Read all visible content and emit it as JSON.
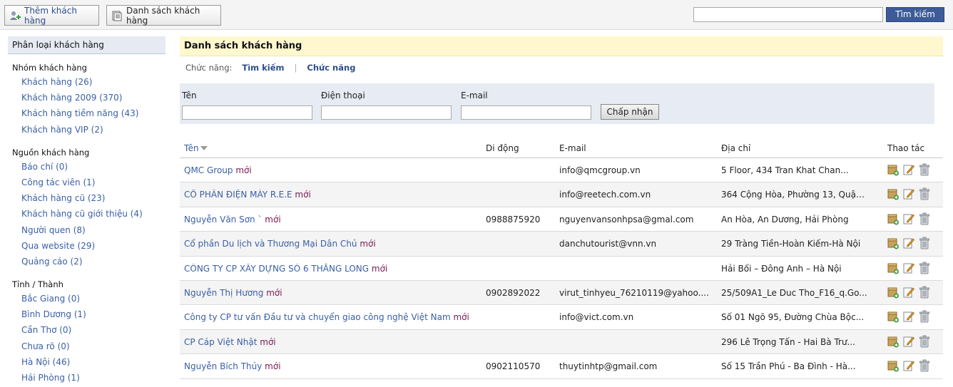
{
  "toolbar": {
    "add_label": "Thêm khách hàng",
    "list_label": "Danh sách khách hàng",
    "search_value": "",
    "search_button": "Tìm kiếm"
  },
  "sidebar": {
    "title": "Phân loại khách hàng",
    "groups": [
      {
        "title": "Nhóm khách hàng",
        "items": [
          "Khách hàng (26)",
          "Khách hàng 2009 (370)",
          "Khách hàng tiềm năng (43)",
          "Khách hàng VIP (2)"
        ]
      },
      {
        "title": "Nguồn khách hàng",
        "items": [
          "Báo chí (0)",
          "Công tác viên (1)",
          "Khách hàng cũ (23)",
          "Khách hàng cũ giới thiệu (4)",
          "Người quen (8)",
          "Qua website (29)",
          "Quảng cáo (2)"
        ]
      },
      {
        "title": "Tỉnh / Thành",
        "items": [
          "Bắc Giang (0)",
          "Bình Dương (1)",
          "Cần Thơ (0)",
          "Chưa rõ (0)",
          "Hà Nội (46)",
          "Hải Phòng (1)"
        ]
      }
    ]
  },
  "main": {
    "title": "Danh sách khách hàng",
    "funcs_label": "Chức năng:",
    "funcs_search": "Tìm kiếm",
    "funcs_sep": "|",
    "funcs_func": "Chức năng"
  },
  "filter": {
    "name_label": "Tên",
    "phone_label": "Điện thoại",
    "email_label": "E-mail",
    "name_value": "",
    "phone_value": "",
    "email_value": "",
    "submit": "Chấp nhận"
  },
  "table": {
    "headers": {
      "name": "Tên",
      "mobile": "Di động",
      "email": "E-mail",
      "address": "Địa chỉ",
      "actions": "Thao tác"
    },
    "new_tag": "mới",
    "rows": [
      {
        "name": "QMC Group",
        "mobile": "",
        "email": "info@qmcgroup.vn",
        "address": "5 Floor, 434 Tran Khat Chan..."
      },
      {
        "name": "CỔ PHẦN ĐIỆN MÁY R.E.E",
        "mobile": "",
        "email": "info@reetech.com.vn",
        "address": "364 Cộng Hòa, Phường 13, Quận..."
      },
      {
        "name": "Nguyễn Văn Sơn `",
        "mobile": "0988875920",
        "email": "nguyenvansonhpsa@gmal.com",
        "address": "An Hòa, An Dương, Hải Phòng"
      },
      {
        "name": "Cổ phần Du lịch và Thương Mại Dân Chủ",
        "mobile": "",
        "email": "danchutourist@vnn.vn",
        "address": "29 Tràng Tiền-Hoàn Kiếm-Hà Nội"
      },
      {
        "name": "CÔNG TY CP XÂY DỰNG SỐ 6 THĂNG LONG",
        "mobile": "",
        "email": "",
        "address": "Hải Bối – Đông Anh – Hà Nội"
      },
      {
        "name": "Nguyễn Thị Hương",
        "mobile": "0902892022",
        "email": "virut_tinhyeu_76210119@yahoo....",
        "address": "25/509A1_Le Duc Tho_F16_q.Go..."
      },
      {
        "name": "Công ty CP tư vấn Đầu tư và chuyển giao công nghệ Việt Nam",
        "mobile": "",
        "email": "info@vict.com.vn",
        "address": "Số 01 Ngõ 95, Đường Chùa Bộc..."
      },
      {
        "name": "CP Cáp Việt Nhật",
        "mobile": "",
        "email": "",
        "address": "296 Lê Trọng Tấn - Hai Bà Trư..."
      },
      {
        "name": "Nguyễn Bích Thủy",
        "mobile": "0902110570",
        "email": "thuytinhtp@gmail.com",
        "address": "Số 15 Trần Phú - Ba Đình - Hà..."
      }
    ]
  },
  "colors": {
    "link": "#3a5fa5",
    "new_tag": "#7a1b53",
    "title_bar": "#fff8cf",
    "filter_bg": "#e7ebf3",
    "search_btn": "#3d5b99"
  },
  "icons": [
    "add-customer-icon",
    "list-icon",
    "add-to-group-icon",
    "edit-icon",
    "trash-icon",
    "sort-down-icon"
  ]
}
